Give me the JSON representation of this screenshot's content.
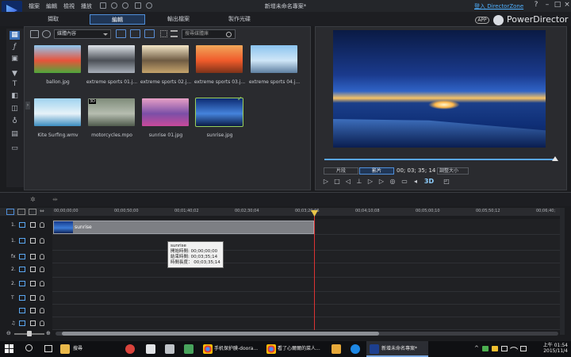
{
  "menubar": {
    "items": [
      "檔案",
      "編輯",
      "檢視",
      "播放"
    ],
    "title": "新增未命名專案*",
    "director_zone": "登入 DirectorZone",
    "help": "?",
    "minimize": "–",
    "maximize": "□",
    "close": "×"
  },
  "tabs": [
    "擷取",
    "編輯",
    "輸出檔案",
    "製作光碟"
  ],
  "brand": {
    "app_badge": "APP",
    "name": "PowerDirector"
  },
  "library": {
    "filter": "媒體內容",
    "search_placeholder": "搜尋媒體庫",
    "items": [
      {
        "name": "ballon.jpg",
        "colors": [
          "#8fc8f0",
          "#e7533b",
          "#4ea83b"
        ]
      },
      {
        "name": "extreme sports 01.j...",
        "colors": [
          "#dfe4ea",
          "#4b4f56",
          "#a9b0ba"
        ]
      },
      {
        "name": "extreme sports 02.j...",
        "colors": [
          "#f3e6c7",
          "#6f5b43",
          "#c5a46c"
        ]
      },
      {
        "name": "extreme sports 03.j...",
        "colors": [
          "#f1a85a",
          "#f05b2b",
          "#7d3219"
        ]
      },
      {
        "name": "extreme sports 04.j...",
        "colors": [
          "#8bc4ef",
          "#cfe6f7",
          "#5d7ea0"
        ]
      },
      {
        "name": "Kite Surfing.wmv",
        "colors": [
          "#9fd3ef",
          "#e7f2f8",
          "#3b8cbf"
        ]
      },
      {
        "name": "motorcycles.mpo",
        "badge": "3D",
        "colors": [
          "#7f8c7a",
          "#b6bdb0",
          "#4f5b4d"
        ]
      },
      {
        "name": "sunrise 01.jpg",
        "colors": [
          "#e7a0c6",
          "#7b4fa7",
          "#c84a9b"
        ]
      },
      {
        "name": "sunrise.jpg",
        "selected": true,
        "colors": [
          "#0d2a72",
          "#4583dc",
          "#0a1a44"
        ]
      }
    ]
  },
  "preview": {
    "mode_clip": "片段",
    "mode_movie": "影片",
    "timecode": "00; 03; 35; 14",
    "size": "調整大小",
    "three_d": "3D"
  },
  "timeline": {
    "ruler": [
      "00;00;00;00",
      "00;00;50;00",
      "00;01;40;02",
      "00;02;30;04",
      "00;03;20;06",
      "00;04;10;08",
      "00;05;00;10",
      "00;05;50;12",
      "00;06;40;"
    ],
    "tracks": [
      "1.",
      "1.",
      "fx",
      "2.",
      "2.",
      "T",
      "",
      "♫"
    ],
    "clip_label": "sunrise",
    "tooltip": {
      "title": "sunrise",
      "start": "開始時間: 00;00;00;00",
      "end": "結束時間: 00;03;35;14",
      "duration": "時間長度： 00;03;35;14"
    }
  },
  "taskbar": {
    "search_item": "搜尋",
    "app1": "手机保护膜-doora...",
    "app2": "看了心爾爾的菜人...",
    "app3": "新增未命名專案*",
    "time": "上午 01:54",
    "date": "2015/11/4"
  }
}
